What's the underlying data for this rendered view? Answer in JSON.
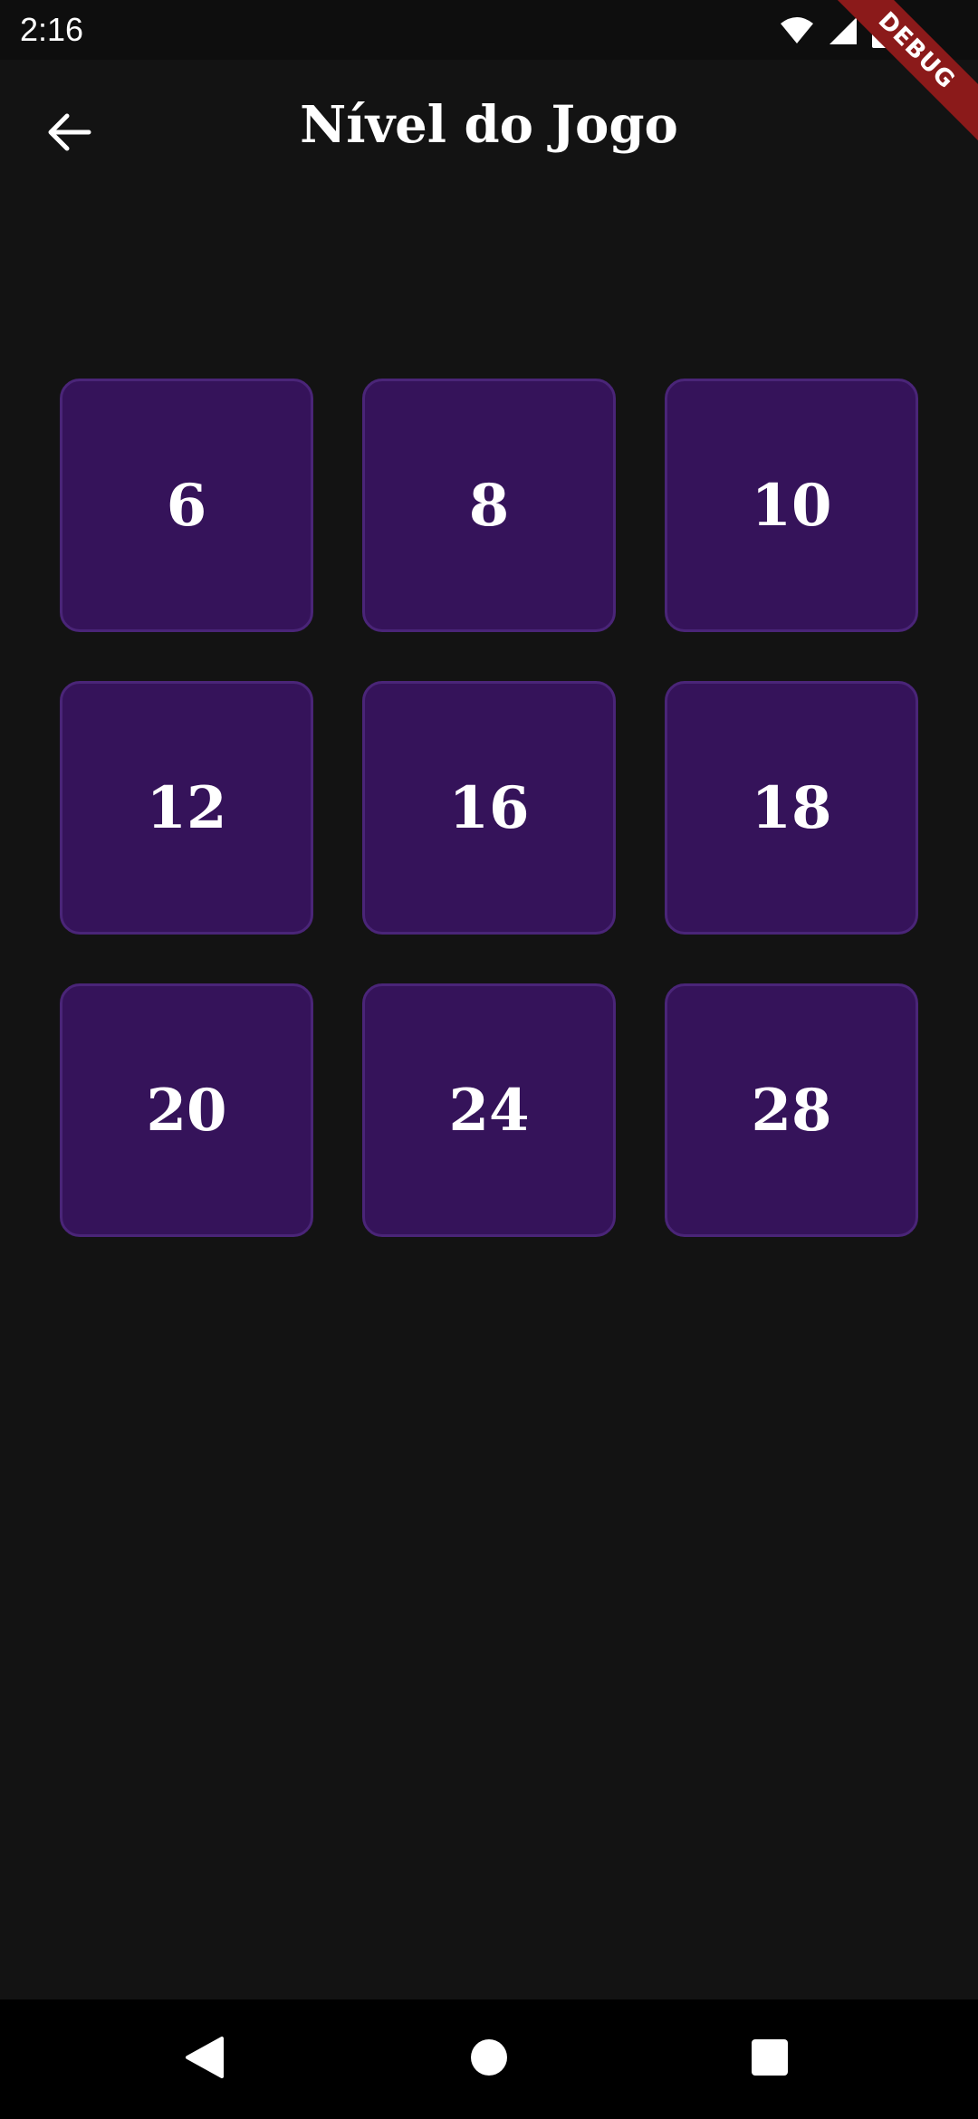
{
  "status_bar": {
    "time": "2:16",
    "icons": [
      "wifi-icon",
      "cellular-signal-icon",
      "battery-icon"
    ]
  },
  "debug_banner": {
    "label": "DEBUG",
    "color": "#8b1a1a"
  },
  "app_bar": {
    "title": "Nível do Jogo",
    "back_icon": "arrow-back-icon"
  },
  "levels": [
    "6",
    "8",
    "10",
    "12",
    "16",
    "18",
    "20",
    "24",
    "28"
  ],
  "colors": {
    "background": "#131313",
    "tile": "#35135a",
    "tile_border": "#4a2578",
    "text": "#ffffff"
  },
  "nav_bar": {
    "icons": [
      "nav-back-icon",
      "nav-home-icon",
      "nav-recents-icon"
    ]
  }
}
